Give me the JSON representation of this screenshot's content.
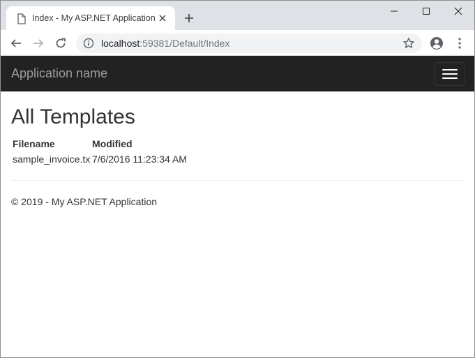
{
  "browser": {
    "tab": {
      "title": "Index - My ASP.NET Application"
    },
    "omnibox": {
      "host": "localhost",
      "rest": ":59381/Default/Index"
    }
  },
  "site": {
    "brand": "Application name",
    "page_title": "All Templates",
    "table": {
      "headers": [
        "Filename",
        "Modified"
      ],
      "rows": [
        {
          "filename": "sample_invoice.tx",
          "modified": "7/6/2016 11:23:34 AM"
        }
      ]
    },
    "footer": "© 2019 - My ASP.NET Application"
  },
  "colors": {
    "navbar_bg": "#222222",
    "brand_text": "#9d9d9d",
    "tabstrip_bg": "#dee1e6",
    "omnibox_bg": "#f1f3f4"
  }
}
